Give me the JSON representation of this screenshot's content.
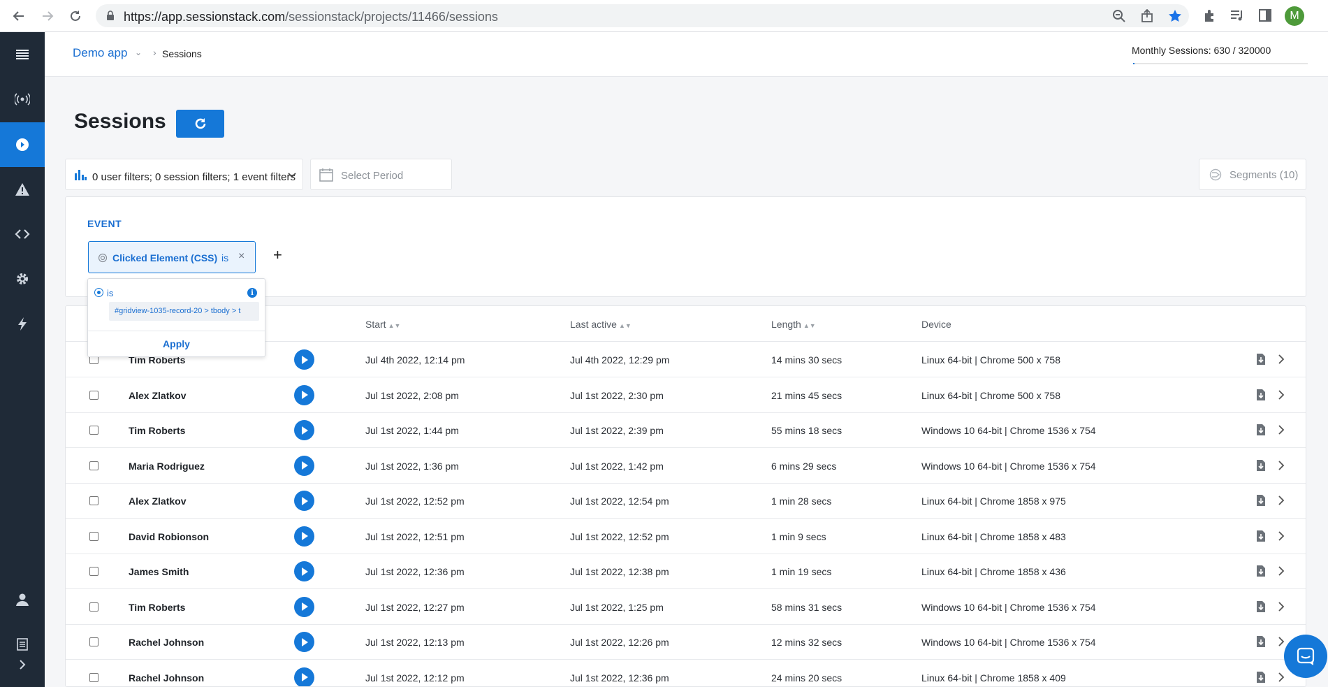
{
  "browser": {
    "url_host": "https://app.sessionstack.com",
    "url_path": "/sessionstack/projects/11466/sessions",
    "profile_initial": "M"
  },
  "sidebar": {
    "items": [
      {
        "icon": "menu-icon"
      },
      {
        "icon": "broadcast-icon"
      },
      {
        "icon": "play-icon",
        "active": true
      },
      {
        "icon": "warning-icon"
      },
      {
        "icon": "code-icon"
      },
      {
        "icon": "gear-icon"
      },
      {
        "icon": "bolt-icon"
      },
      {
        "icon": "user-icon"
      },
      {
        "icon": "document-icon"
      },
      {
        "icon": "chevron-right-icon"
      }
    ]
  },
  "topbar": {
    "app_name": "Demo app",
    "breadcrumb_current": "Sessions",
    "monthly_sessions": "Monthly Sessions: 630 / 320000",
    "monthly_usage_fraction": 0.002
  },
  "page": {
    "title": "Sessions"
  },
  "filters": {
    "summary": "0 user filters; 0 session filters; 1 event filters",
    "period_placeholder": "Select Period",
    "segments_label": "Segments (10)"
  },
  "event_panel": {
    "label": "EVENT",
    "chip_name": "Clicked Element (CSS)",
    "chip_operator": "is",
    "add_symbol": "+"
  },
  "popover": {
    "option_label": "is",
    "value": "#gridview-1035-record-20 > tbody > t",
    "apply_label": "Apply"
  },
  "table": {
    "headers": {
      "start": "Start",
      "last_active": "Last active",
      "length": "Length",
      "device": "Device"
    },
    "rows": [
      {
        "user": "Tim Roberts",
        "start": "Jul 4th 2022, 12:14 pm",
        "last_active": "Jul 4th 2022, 12:29 pm",
        "length": "14 mins 30 secs",
        "device": "Linux 64-bit | Chrome 500 x 758"
      },
      {
        "user": "Alex Zlatkov",
        "start": "Jul 1st 2022, 2:08 pm",
        "last_active": "Jul 1st 2022, 2:30 pm",
        "length": "21 mins 45 secs",
        "device": "Linux 64-bit | Chrome 500 x 758"
      },
      {
        "user": "Tim Roberts",
        "start": "Jul 1st 2022, 1:44 pm",
        "last_active": "Jul 1st 2022, 2:39 pm",
        "length": "55 mins 18 secs",
        "device": "Windows 10 64-bit | Chrome 1536 x 754"
      },
      {
        "user": "Maria Rodriguez",
        "start": "Jul 1st 2022, 1:36 pm",
        "last_active": "Jul 1st 2022, 1:42 pm",
        "length": "6 mins 29 secs",
        "device": "Windows 10 64-bit | Chrome 1536 x 754"
      },
      {
        "user": "Alex Zlatkov",
        "start": "Jul 1st 2022, 12:52 pm",
        "last_active": "Jul 1st 2022, 12:54 pm",
        "length": "1 min 28 secs",
        "device": "Linux 64-bit | Chrome 1858 x 975"
      },
      {
        "user": "David Robionson",
        "start": "Jul 1st 2022, 12:51 pm",
        "last_active": "Jul 1st 2022, 12:52 pm",
        "length": "1 min 9 secs",
        "device": "Linux 64-bit | Chrome 1858 x 483"
      },
      {
        "user": "James Smith",
        "start": "Jul 1st 2022, 12:36 pm",
        "last_active": "Jul 1st 2022, 12:38 pm",
        "length": "1 min 19 secs",
        "device": "Linux 64-bit | Chrome 1858 x 436"
      },
      {
        "user": "Tim Roberts",
        "start": "Jul 1st 2022, 12:27 pm",
        "last_active": "Jul 1st 2022, 1:25 pm",
        "length": "58 mins 31 secs",
        "device": "Windows 10 64-bit | Chrome 1536 x 754"
      },
      {
        "user": "Rachel Johnson",
        "start": "Jul 1st 2022, 12:13 pm",
        "last_active": "Jul 1st 2022, 12:26 pm",
        "length": "12 mins 32 secs",
        "device": "Windows 10 64-bit | Chrome 1536 x 754"
      },
      {
        "user": "Rachel Johnson",
        "start": "Jul 1st 2022, 12:12 pm",
        "last_active": "Jul 1st 2022, 12:36 pm",
        "length": "24 mins 20 secs",
        "device": "Linux 64-bit | Chrome 1858 x 409"
      }
    ]
  },
  "colors": {
    "accent": "#1578d8",
    "sidebar_bg": "#1f2a37"
  }
}
